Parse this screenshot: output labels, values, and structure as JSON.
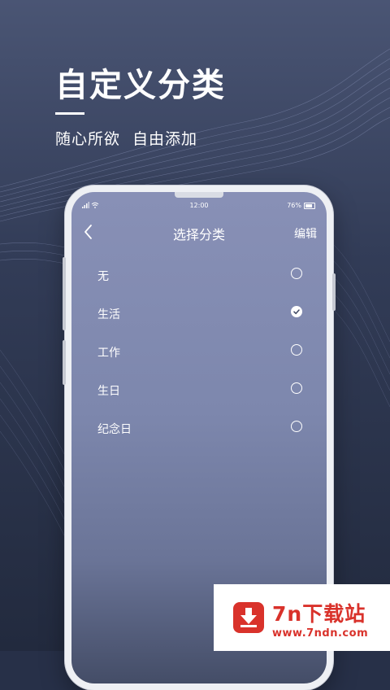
{
  "promo": {
    "title": "自定义分类",
    "subtitle": "随心所欲  自由添加"
  },
  "status_bar": {
    "time": "12:00",
    "battery": "76%",
    "battery_level": 0.76
  },
  "nav": {
    "back_icon": "chevron-left-icon",
    "title": "选择分类",
    "edit_label": "编辑"
  },
  "categories": [
    {
      "label": "无",
      "selected": false
    },
    {
      "label": "生活",
      "selected": true
    },
    {
      "label": "工作",
      "selected": false
    },
    {
      "label": "生日",
      "selected": false
    },
    {
      "label": "纪念日",
      "selected": false
    }
  ],
  "watermark": {
    "name": "7n下载站",
    "url": "www.7ndn.com",
    "icon": "download-arrow-icon"
  },
  "colors": {
    "background": "#273048",
    "screen_top": "#8890b6",
    "accent_check": "#3f4863",
    "watermark_red": "#d9322b"
  }
}
